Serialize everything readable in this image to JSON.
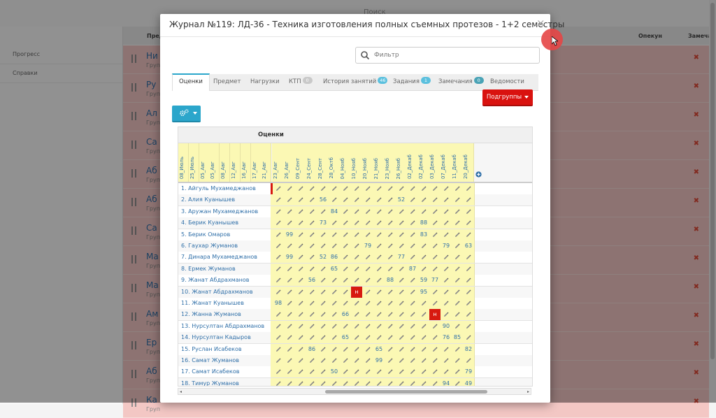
{
  "background": {
    "search_hint": "Поиск",
    "sidebar_items": [
      "Прогресс",
      "Справки"
    ],
    "header_cols": [
      {
        "label": "Пред"
      },
      {
        "label": "Опекун"
      },
      {
        "label": "Замечан."
      }
    ],
    "rows": [
      {
        "title": "Ни",
        "sub": "Груп"
      },
      {
        "title": "Ру",
        "sub": "Груп"
      },
      {
        "title": "Ал",
        "sub": "Груп"
      },
      {
        "title": "Са",
        "sub": "Груп"
      },
      {
        "title": "Аб",
        "sub": "Груп"
      },
      {
        "title": "Аб",
        "sub": "Груп"
      },
      {
        "title": "Са",
        "sub": "Груп"
      },
      {
        "title": "Ма",
        "sub": "Груп"
      },
      {
        "title": "Ма",
        "sub": "Груп"
      },
      {
        "title": "Ам",
        "sub": "Груп"
      },
      {
        "title": "Ер",
        "sub": "Груп"
      },
      {
        "title": "Аб",
        "sub": "Груп"
      },
      {
        "title": "Ка",
        "sub": "Груп"
      }
    ]
  },
  "modal": {
    "title": "Журнал №119: ЛД-36 - Техника изготовления полных съемных протезов - 1+2 семестры",
    "close": "×",
    "filter_placeholder": "Фильтр",
    "tabs": [
      {
        "label": "Оценки",
        "active": true
      },
      {
        "label": "Предмет"
      },
      {
        "label": "Нагрузки"
      },
      {
        "label": "КТП",
        "badge": "0",
        "badge_color": "gray"
      },
      {
        "label": "История занятий",
        "badge": "46",
        "badge_color": "blue"
      },
      {
        "label": "Задания",
        "badge": "1",
        "badge_color": "blue"
      },
      {
        "label": "Замечания",
        "badge": "0",
        "badge_color": "teal"
      },
      {
        "label": "Ведомости"
      }
    ],
    "subgroups_button": "Подгруппы",
    "grid_caption": "Оценки",
    "dates": [
      "08_Июль",
      "25_Июль",
      "05_Авг",
      "05_Авг",
      "08_Авг",
      "12_Авг",
      "16_Авг",
      "17_Авг",
      "21_Авг",
      "23_Авг",
      "26_Авг",
      "09_Сент",
      "24_Сент",
      "28_Сент",
      "28_Октб",
      "04_Нояб",
      "10_Нояб",
      "20_Нояб",
      "21_Нояб",
      "23_Нояб",
      "26_Нояб",
      "02_Декаб",
      "02_Декаб",
      "03_Декаб",
      "07_Декаб",
      "11_Декаб",
      "20_Декаб"
    ],
    "students": [
      {
        "name": "1. Айгуль Мухамеджанов",
        "marks": {},
        "absent": [],
        "first_red": true
      },
      {
        "name": "2. Алия Куанышев",
        "marks": {
          "13": "56",
          "20": "52"
        },
        "absent": []
      },
      {
        "name": "3. Аружан Мухамеджанов",
        "marks": {
          "14": "84"
        },
        "absent": []
      },
      {
        "name": "4. Берик Куанышев",
        "marks": {
          "13": "73",
          "22": "88"
        },
        "absent": []
      },
      {
        "name": "5. Берик Омаров",
        "marks": {
          "10": "99",
          "22": "83"
        },
        "absent": []
      },
      {
        "name": "6. Гаухар Жуманов",
        "marks": {
          "17": "79",
          "24": "79",
          "26": "63"
        },
        "absent": []
      },
      {
        "name": "7. Динара Мухамеджанов",
        "marks": {
          "10": "99",
          "13": "52",
          "14": "86",
          "20": "77"
        },
        "absent": []
      },
      {
        "name": "8. Ермек Жуманов",
        "marks": {
          "14": "65",
          "21": "87"
        },
        "absent": []
      },
      {
        "name": "9. Жанат Абдрахманов",
        "marks": {
          "12": "56",
          "19": "88",
          "22": "59",
          "23": "77"
        },
        "absent": []
      },
      {
        "name": "10. Жанат Абдрахманов",
        "marks": {
          "22": "95"
        },
        "absent": [
          "16"
        ],
        "absent_label": "н"
      },
      {
        "name": "11. Жанат Куанышев",
        "marks": {
          "9": "98"
        },
        "absent": []
      },
      {
        "name": "12. Жанна Жуманов",
        "marks": {
          "15": "66"
        },
        "absent": [
          "23"
        ],
        "absent_label": "н"
      },
      {
        "name": "13. Нурсултан Абдрахманов",
        "marks": {
          "24": "90"
        },
        "absent": []
      },
      {
        "name": "14. Нурсултан Кадыров",
        "marks": {
          "15": "65",
          "24": "76",
          "25": "85"
        },
        "absent": []
      },
      {
        "name": "15. Руслан Исабеков",
        "marks": {
          "12": "86",
          "18": "65",
          "26": "82"
        },
        "absent": []
      },
      {
        "name": "16. Самат Жуманов",
        "marks": {
          "18": "99"
        },
        "absent": []
      },
      {
        "name": "17. Самат Исабеков",
        "marks": {
          "14": "50",
          "26": "79"
        },
        "absent": []
      },
      {
        "name": "18. Тимур Жуманов",
        "marks": {
          "24": "94",
          "26": "49"
        },
        "absent": []
      }
    ]
  },
  "colors": {
    "accent": "#2ba6cb",
    "danger": "#d9120f",
    "cell_yellow": "#fbf8b4",
    "link": "#2f6fa8"
  },
  "icons": {
    "search": "search-icon",
    "gear": "gears-icon",
    "edit": "pencil-icon",
    "add": "plus-circle-icon",
    "close": "close-icon"
  }
}
